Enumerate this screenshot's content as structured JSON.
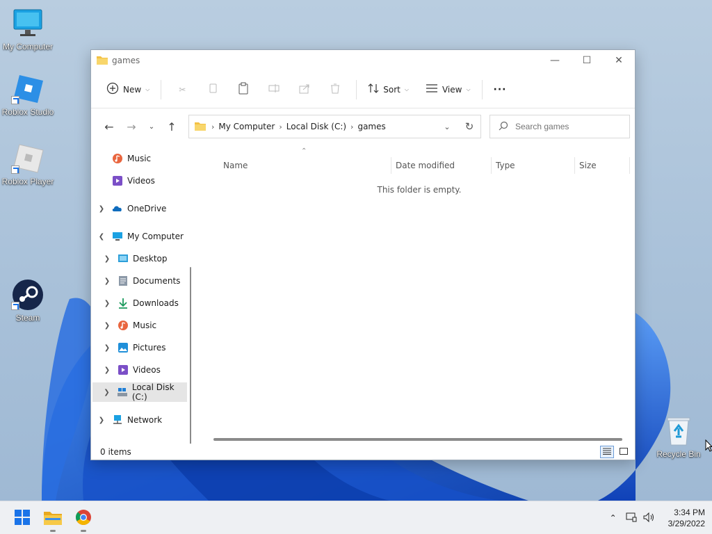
{
  "desktop": {
    "icons": [
      {
        "label": "My Computer"
      },
      {
        "label": "Roblox Studio"
      },
      {
        "label": "Roblox Player"
      },
      {
        "label": "Steam"
      },
      {
        "label": "Recycle Bin"
      }
    ]
  },
  "window": {
    "title": "games",
    "toolbar": {
      "new_label": "New",
      "sort_label": "Sort",
      "view_label": "View",
      "more_label": "···"
    },
    "breadcrumbs": [
      "My Computer",
      "Local Disk (C:)",
      "games"
    ],
    "search": {
      "placeholder": "Search games"
    },
    "nav": {
      "items": [
        {
          "label": "Music"
        },
        {
          "label": "Videos"
        },
        {
          "label": "OneDrive"
        },
        {
          "label": "My Computer"
        },
        {
          "label": "Desktop"
        },
        {
          "label": "Documents"
        },
        {
          "label": "Downloads"
        },
        {
          "label": "Music"
        },
        {
          "label": "Pictures"
        },
        {
          "label": "Videos"
        },
        {
          "label": "Local Disk (C:)"
        },
        {
          "label": "Network"
        }
      ]
    },
    "columns": [
      "Name",
      "Date modified",
      "Type",
      "Size"
    ],
    "empty_message": "This folder is empty.",
    "status": "0 items"
  },
  "taskbar": {
    "time": "3:34 PM",
    "date": "3/29/2022"
  },
  "colors": {
    "accent": "#0067c0",
    "folder": "#f4c144",
    "wallpaper_bloom": "#1a5ed6"
  }
}
